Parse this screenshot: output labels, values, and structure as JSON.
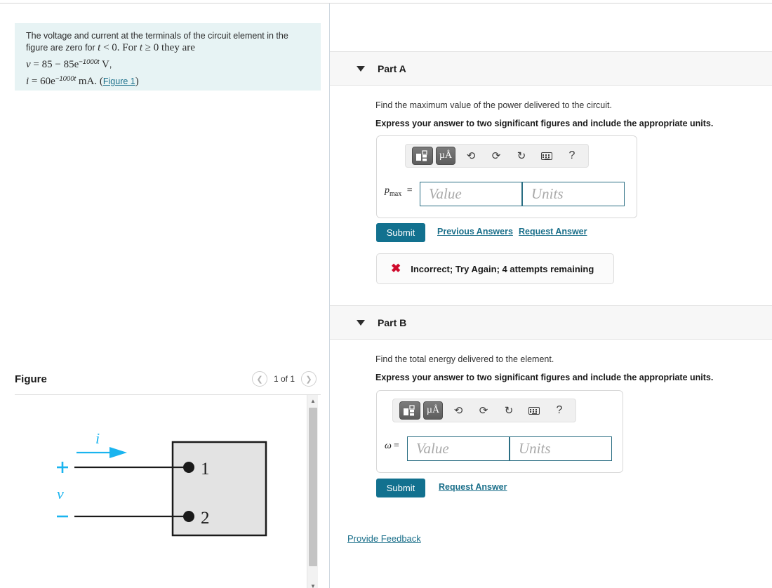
{
  "problem": {
    "line1": "The voltage and current at the terminals of the circuit element in the",
    "line2_pre": "figure are zero for ",
    "line2_t": "t",
    "line2_mid": " < 0. For ",
    "line2_t2": "t",
    "line2_post": " ≥ 0 they are",
    "eq_v_var": "v",
    "eq_v_body": " = 85  −  85e",
    "eq_v_exp": "−1000t",
    "eq_v_unit": " V",
    "eq_v_end": ",",
    "eq_i_var": "i",
    "eq_i_body": " = 60e",
    "eq_i_exp": "−1000t",
    "eq_i_unit": " mA",
    "eq_i_end": ". (",
    "figure_link": "Figure 1",
    "eq_i_close": ")"
  },
  "figure": {
    "title": "Figure",
    "prev_icon": "chevron-left",
    "next_icon": "chevron-right",
    "counter": "1 of 1",
    "labels": {
      "current": "i",
      "plus": "+",
      "voltage": "v",
      "minus": "−",
      "terminal1": "1",
      "terminal2": "2"
    },
    "colors": {
      "annotation": "#1ab4ef",
      "element_fill": "#e3e3e3",
      "element_stroke": "#1a1a1a"
    }
  },
  "parts": [
    {
      "id": "part-a",
      "label": "Part A",
      "caret_icon": "caret-down-icon",
      "question": "Find the maximum value of the power delivered to the circuit.",
      "instruction": "Express your answer to two significant figures and include the appropriate units.",
      "toolbar": {
        "template_button": "math-template",
        "units_button": "µÅ",
        "undo": "↶",
        "redo": "↷",
        "reset": "⟳",
        "keyboard": "keyboard",
        "help": "?"
      },
      "field_label_main": "p",
      "field_label_sub": "max",
      "field_label_eq": "=",
      "value_placeholder": "Value",
      "value_text": "",
      "units_placeholder": "Units",
      "units_text": "",
      "submit_label": "Submit",
      "previous_answers_label": "Previous Answers",
      "request_answer_label": "Request Answer",
      "feedback": {
        "icon": "x-mark-icon",
        "text": "Incorrect; Try Again; 4 attempts remaining"
      }
    },
    {
      "id": "part-b",
      "label": "Part B",
      "caret_icon": "caret-down-icon",
      "question": "Find the total energy delivered to the element.",
      "instruction": "Express your answer to two significant figures and include the appropriate units.",
      "toolbar": {
        "template_button": "math-template",
        "units_button": "µÅ",
        "undo": "↶",
        "redo": "↷",
        "reset": "⟳",
        "keyboard": "keyboard",
        "help": "?"
      },
      "field_label_main": "ω",
      "field_label_sub": "",
      "field_label_eq": "=",
      "value_placeholder": "Value",
      "value_text": "",
      "units_placeholder": "Units",
      "units_text": "",
      "submit_label": "Submit",
      "request_answer_label": "Request Answer"
    }
  ],
  "footer": {
    "provide_feedback": "Provide Feedback"
  },
  "colors": {
    "accent_teal": "#12718f",
    "link": "#1a6f8a",
    "problem_bg": "#e7f3f4",
    "header_bg": "#f7f7f7",
    "error_red": "#cf0a2c"
  }
}
